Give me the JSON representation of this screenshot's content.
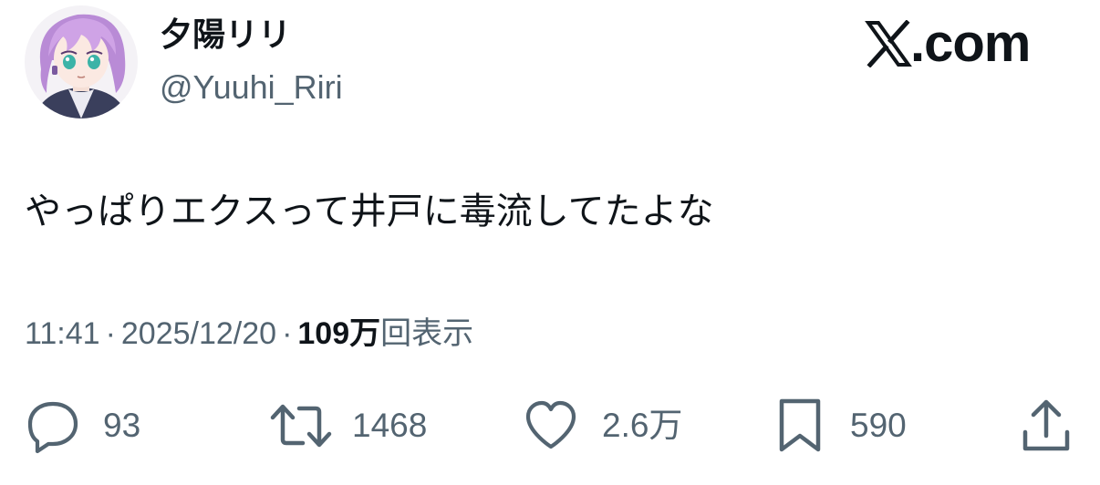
{
  "author": {
    "display_name": "夕陽リリ",
    "handle": "@Yuuhi_Riri",
    "avatar_icon": "avatar-image"
  },
  "brand": {
    "text": ".com",
    "icon": "x-logo-icon"
  },
  "tweet": {
    "text": "やっぱりエクスって井戸に毒流してたよな"
  },
  "meta": {
    "time": "11:41",
    "separator": "·",
    "date": "2025/12/20",
    "views_count": "109万",
    "views_label": "回表示"
  },
  "actions": {
    "reply": {
      "icon": "reply-icon",
      "count": "93"
    },
    "repost": {
      "icon": "repost-icon",
      "count": "1468"
    },
    "like": {
      "icon": "heart-icon",
      "count": "2.6万"
    },
    "bookmark": {
      "icon": "bookmark-icon",
      "count": "590"
    },
    "share": {
      "icon": "share-icon"
    }
  },
  "colors": {
    "text_primary": "#0f1419",
    "text_secondary": "#536471",
    "avatar_hair": "#c79be0",
    "avatar_bg": "#f4f2f6"
  }
}
